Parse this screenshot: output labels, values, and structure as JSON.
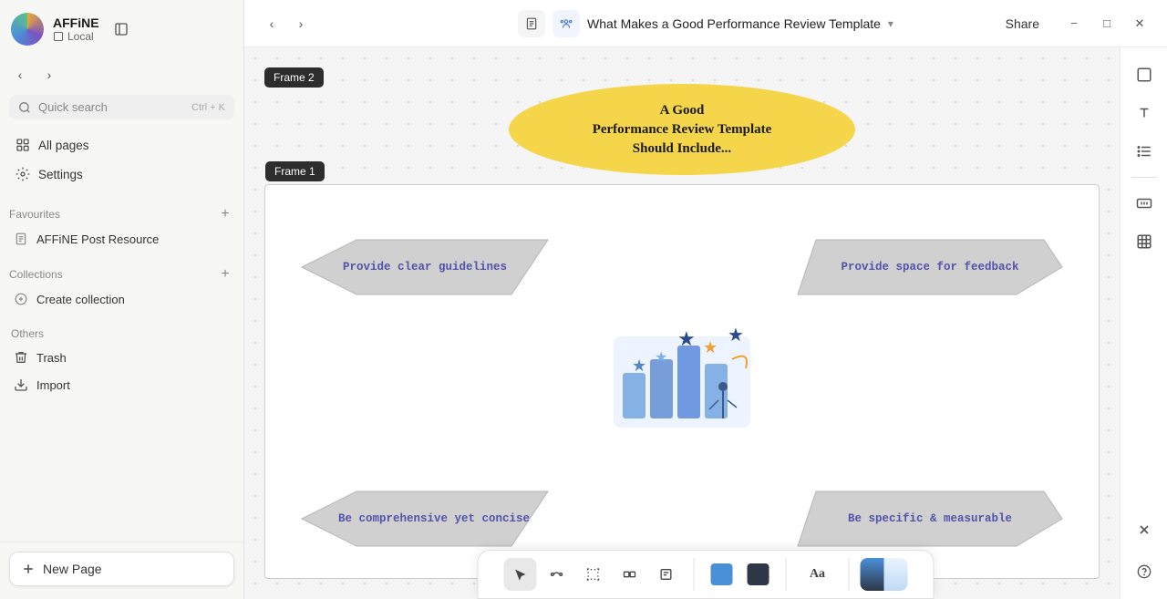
{
  "app": {
    "name": "AFFiNE",
    "workspace_type": "Local"
  },
  "sidebar": {
    "quick_search_label": "Quick search",
    "quick_search_shortcut": "Ctrl + K",
    "nav_items": [
      {
        "id": "all-pages",
        "label": "All pages",
        "icon": "pages-icon"
      },
      {
        "id": "settings",
        "label": "Settings",
        "icon": "settings-icon"
      }
    ],
    "favourites_title": "Favourites",
    "favourites_items": [
      {
        "label": "AFFiNE Post Resource"
      }
    ],
    "collections_title": "Collections",
    "create_collection_label": "Create collection",
    "others_title": "Others",
    "others_items": [
      {
        "id": "trash",
        "label": "Trash",
        "icon": "trash-icon"
      },
      {
        "id": "import",
        "label": "Import",
        "icon": "import-icon"
      }
    ],
    "new_page_label": "New Page"
  },
  "titlebar": {
    "doc_title": "What Makes a Good Performance Review Template",
    "share_label": "Share"
  },
  "canvas": {
    "frame2_label": "Frame 2",
    "frame1_label": "Frame 1",
    "oval_text": "A Good\nPerformance Review Template\nShould Include...",
    "diamonds": [
      {
        "id": "d1",
        "text": "Provide clear guidelines"
      },
      {
        "id": "d2",
        "text": "Provide space for feedback"
      },
      {
        "id": "d3",
        "text": "Be comprehensive yet concise"
      },
      {
        "id": "d4",
        "text": "Be specific & measurable"
      }
    ]
  },
  "right_panel": {
    "buttons": [
      {
        "id": "frame-btn",
        "icon": "□",
        "tooltip": "Frame"
      },
      {
        "id": "text-btn",
        "icon": "T",
        "tooltip": "Text"
      },
      {
        "id": "list-btn",
        "icon": "≡",
        "tooltip": "List"
      },
      {
        "id": "embed-btn",
        "icon": "⊞",
        "tooltip": "Embed"
      },
      {
        "id": "table-btn",
        "icon": "⊟",
        "tooltip": "Table"
      }
    ],
    "close_icon": "×",
    "help_icon": "?"
  },
  "toolbar": {
    "tools": [
      {
        "id": "select",
        "icon": "cursor",
        "active": true
      },
      {
        "id": "connector",
        "icon": "connector"
      },
      {
        "id": "frame",
        "icon": "frame"
      },
      {
        "id": "group",
        "icon": "group"
      },
      {
        "id": "note",
        "icon": "note"
      }
    ],
    "colors": [
      {
        "id": "blue",
        "color": "#4a90d9"
      },
      {
        "id": "dark",
        "color": "#2d3748"
      }
    ],
    "text_btn": "Aa",
    "theme_btn": "theme"
  }
}
